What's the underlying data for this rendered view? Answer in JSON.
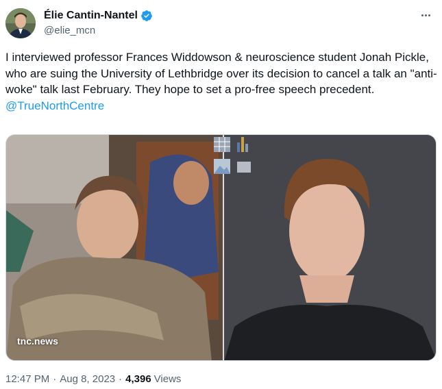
{
  "author": {
    "name": "Élie Cantin-Nantel",
    "handle": "@elie_mcn",
    "verified": true
  },
  "tweet": {
    "text": "I interviewed professor Frances Widdowson & neuroscience student Jonah Pickle, who are suing the University of Lethbridge over its decision to cancel a talk an \"anti-woke\" talk last February. They hope to set a pro-free speech precedent. ",
    "mention": "@TrueNorthCentre"
  },
  "media": {
    "watermark": "tnc.news"
  },
  "meta": {
    "time": "12:47 PM",
    "date": "Aug 8, 2023",
    "separator": "·",
    "views_count": "4,396",
    "views_label": "Views"
  },
  "colors": {
    "accent": "#1d9bf0",
    "text": "#0f1419",
    "secondary": "#536471"
  },
  "icons": [
    "verified-badge-icon",
    "more-options-icon"
  ]
}
